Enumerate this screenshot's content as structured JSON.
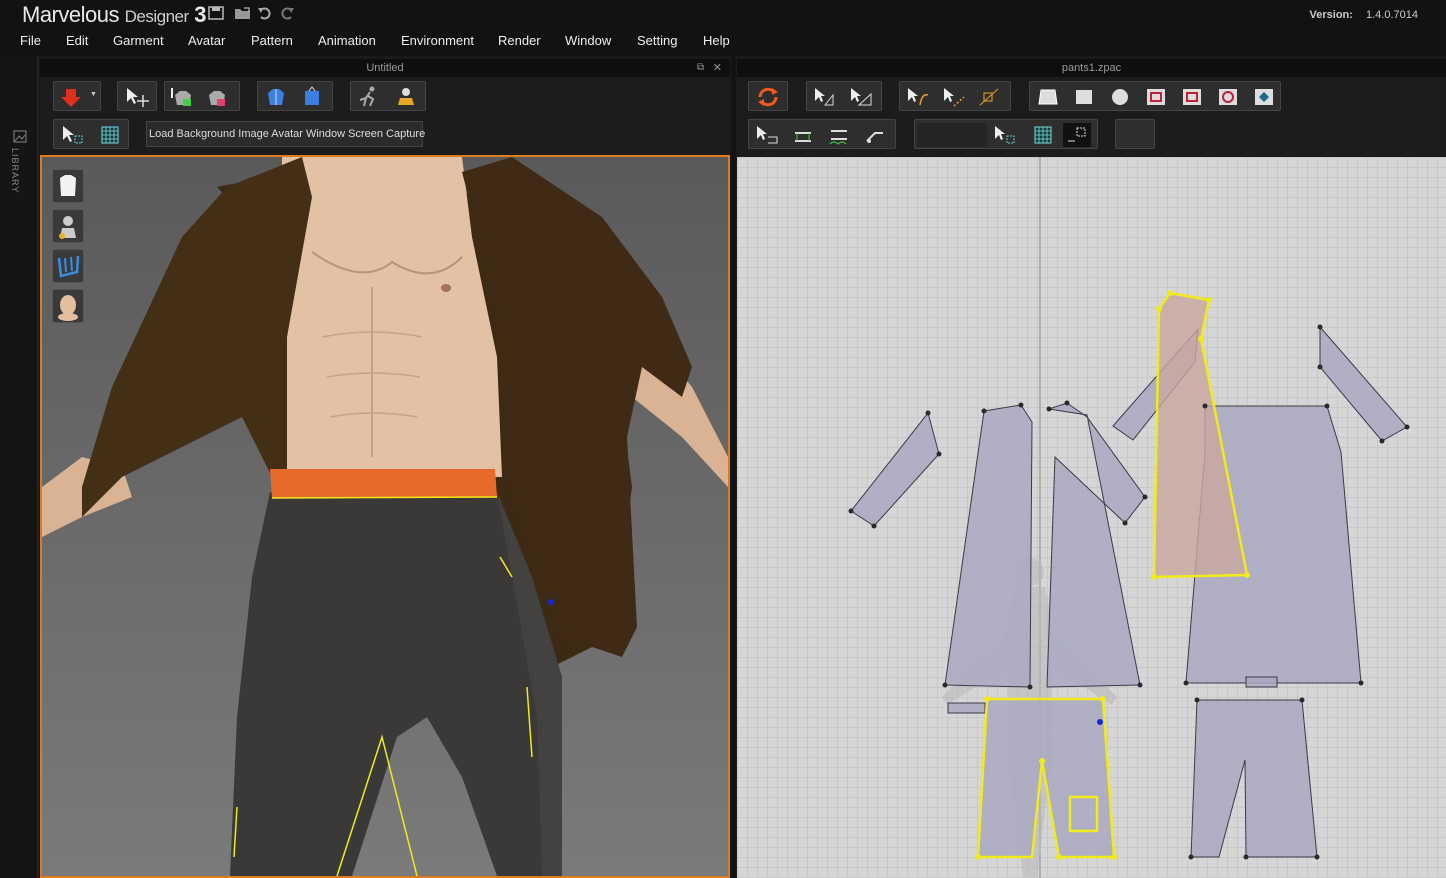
{
  "app": {
    "title_main": "Marvelous",
    "title_sub": "Designer",
    "title_num": "3",
    "version_label": "Version:",
    "version_value": "1.4.0.7014"
  },
  "menu": [
    "File",
    "Edit",
    "Garment",
    "Avatar",
    "Pattern",
    "Animation",
    "Environment",
    "Render",
    "Window",
    "Setting",
    "Help"
  ],
  "sidebar": {
    "library_label": "LIBRARY"
  },
  "panel3d": {
    "title": "Untitled",
    "capture_button": "Load Background Image Avatar Window Screen Capture"
  },
  "panel2d": {
    "title": "pants1.zpac"
  },
  "colors": {
    "accent_orange": "#e07a1f",
    "selection_yellow": "#f2ea1a",
    "pattern_fill": "#a9a8bf",
    "selected_pattern_fill": "#c9a79f"
  },
  "icons": {
    "titlebar": [
      "save-icon",
      "open-folder-icon",
      "undo-icon",
      "redo-icon"
    ],
    "side": [
      "garment-icon",
      "avatar-icon",
      "arrangement-icon",
      "head-icon"
    ]
  }
}
